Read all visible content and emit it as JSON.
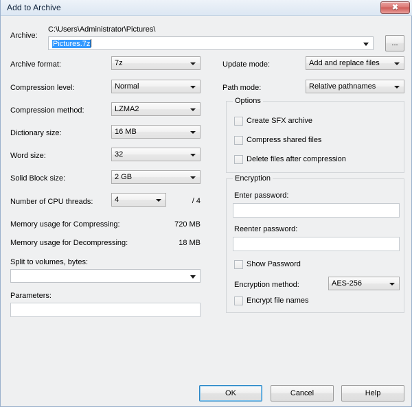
{
  "window": {
    "title": "Add to Archive",
    "close_label": "✖"
  },
  "archive": {
    "label": "Archive:",
    "path": "C:\\Users\\Administrator\\Pictures\\",
    "filename": "Pictures.7z",
    "browse_label": "..."
  },
  "left": {
    "archive_format": {
      "label": "Archive format:",
      "value": "7z"
    },
    "compression_level": {
      "label": "Compression level:",
      "value": "Normal"
    },
    "compression_method": {
      "label": "Compression method:",
      "value": "LZMA2"
    },
    "dictionary_size": {
      "label": "Dictionary size:",
      "value": "16 MB"
    },
    "word_size": {
      "label": "Word size:",
      "value": "32"
    },
    "solid_block_size": {
      "label": "Solid Block size:",
      "value": "2 GB"
    },
    "cpu_threads": {
      "label": "Number of CPU threads:",
      "value": "4",
      "total": "/ 4"
    },
    "mem_compress": {
      "label": "Memory usage for Compressing:",
      "value": "720 MB"
    },
    "mem_decompress": {
      "label": "Memory usage for Decompressing:",
      "value": "18 MB"
    },
    "split_volumes": {
      "label": "Split to volumes, bytes:",
      "value": ""
    },
    "parameters": {
      "label": "Parameters:",
      "value": ""
    }
  },
  "right": {
    "update_mode": {
      "label": "Update mode:",
      "value": "Add and replace files"
    },
    "path_mode": {
      "label": "Path mode:",
      "value": "Relative pathnames"
    },
    "options": {
      "title": "Options",
      "items": [
        {
          "label": "Create SFX archive",
          "checked": false
        },
        {
          "label": "Compress shared files",
          "checked": false
        },
        {
          "label": "Delete files after compression",
          "checked": false
        }
      ]
    },
    "encryption": {
      "title": "Encryption",
      "enter_password_label": "Enter password:",
      "enter_password_value": "",
      "reenter_password_label": "Reenter password:",
      "reenter_password_value": "",
      "show_password": {
        "label": "Show Password",
        "checked": false
      },
      "method_label": "Encryption method:",
      "method_value": "AES-256",
      "encrypt_file_names": {
        "label": "Encrypt file names",
        "checked": false
      }
    }
  },
  "buttons": {
    "ok": "OK",
    "cancel": "Cancel",
    "help": "Help"
  }
}
